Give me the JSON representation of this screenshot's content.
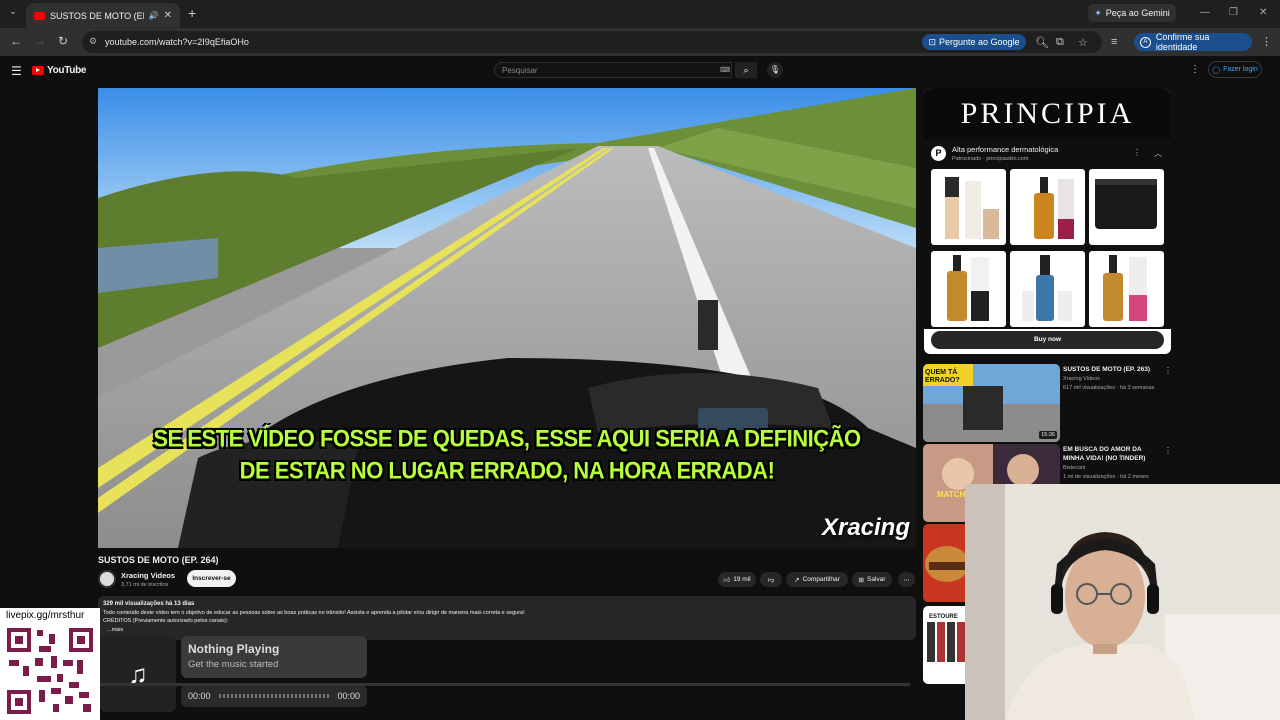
{
  "browser": {
    "tab_title": "SUSTOS DE MOTO (EP. 264)",
    "new_tab": "+",
    "gemini_label": "Peça ao Gemini",
    "url": "youtube.com/watch?v=2I9qEfiaOHo",
    "ask_google": "Pergunte ao Google",
    "identity": "Confirme sua identidade"
  },
  "youtube": {
    "logo": "YouTube",
    "search_placeholder": "Pesquisar",
    "login": "Fazer login"
  },
  "video": {
    "subtitle_line1": "SE ESTE VÍDEO FOSSE DE QUEDAS, ESSE AQUI SERIA A DEFINIÇÃO",
    "subtitle_line2": "DE ESTAR NO LUGAR ERRADO, NA HORA ERRADA!",
    "watermark": "Xracing",
    "title": "SUSTOS DE MOTO (EP. 264)",
    "channel": "Xracing Videos",
    "subscribers": "3,71 mi de inscritos",
    "subscribe": "Inscrever-se",
    "likes": "19 mil",
    "share": "Compartilhar",
    "save": "Salvar",
    "views": "329 mil visualizações  há 13 dias",
    "description": "Todo conteúdo deste vídeo tem o objetivo de educar as pessoas sobre as boas práticas no trânsito! Assista e aprenda a pilotar e/ou dirigir de maneira mais correta e segura!",
    "credits": "CRÉDITOS (Previamente autorizado pelos canais):",
    "more": "...mais"
  },
  "ad": {
    "brand": "PRINCIPIA",
    "tagline": "Alta performance dermatológica",
    "sponsored": "Patrocinado · principiaskin.com",
    "buy": "Buy now"
  },
  "recommendations": [
    {
      "title": "SUSTOS DE MOTO (EP. 263)",
      "channel": "Xracing Videos",
      "meta": "617 mil visualizações · há 3 semanas",
      "duration": "15:36",
      "thumb_text": "QUEM TÁ ERRADO?"
    },
    {
      "title": "EM BUSCA DO AMOR DA MINHA VIDA! (NO TINDER)",
      "channel": "Bisteconi",
      "meta": "1 mi de visualizações · há 2 meses",
      "duration": "",
      "thumb_text": "MATCH"
    },
    {
      "title": "",
      "channel": "",
      "meta": "",
      "duration": "",
      "thumb_text": ""
    },
    {
      "title": "",
      "channel": "",
      "meta": "",
      "duration": "",
      "thumb_text": "ESTOURE"
    }
  ],
  "overlay": {
    "qr_label": "livepix.gg/mrsthur",
    "now_playing": "Nothing Playing",
    "now_playing_sub": "Get the music started",
    "time_start": "00:00",
    "time_end": "00:00"
  }
}
